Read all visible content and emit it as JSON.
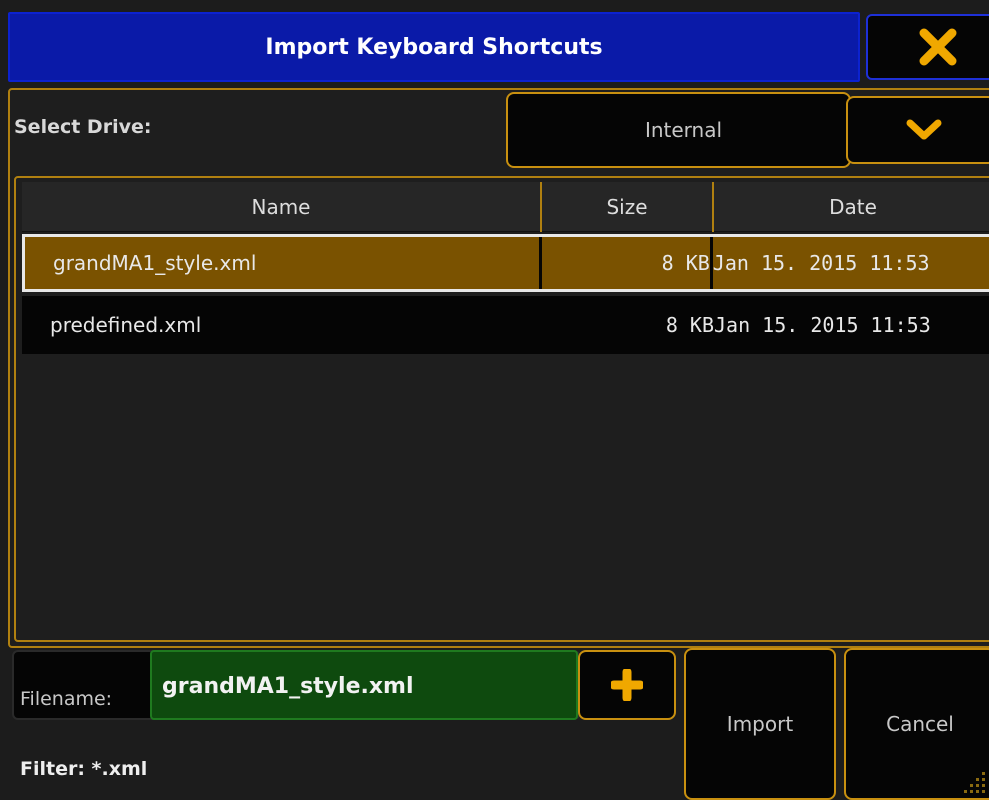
{
  "dialog": {
    "title": "Import Keyboard Shortcuts",
    "close_icon": "close-x-icon"
  },
  "drive": {
    "label": "Select Drive:",
    "selected": "Internal",
    "toggle_icon": "chevron-down-icon"
  },
  "filelist": {
    "columns": [
      "Name",
      "Size",
      "Date"
    ],
    "rows": [
      {
        "name": "grandMA1_style.xml",
        "size": "8 KB",
        "date": "Jan 15. 2015 11:53",
        "selected": true
      },
      {
        "name": "predefined.xml",
        "size": "8 KB",
        "date": "Jan 15. 2015 11:53",
        "selected": false
      }
    ]
  },
  "filename": {
    "label": "Filename:",
    "value": "grandMA1_style.xml",
    "add_icon": "plus-icon"
  },
  "filter": {
    "text": "Filter: *.xml"
  },
  "actions": {
    "import_label": "Import",
    "cancel_label": "Cancel"
  },
  "colors": {
    "title_bar": "#0a1aa8",
    "accent": "#c89010",
    "selected_row": "#7a5200",
    "filename_field": "#0e4a0e"
  }
}
